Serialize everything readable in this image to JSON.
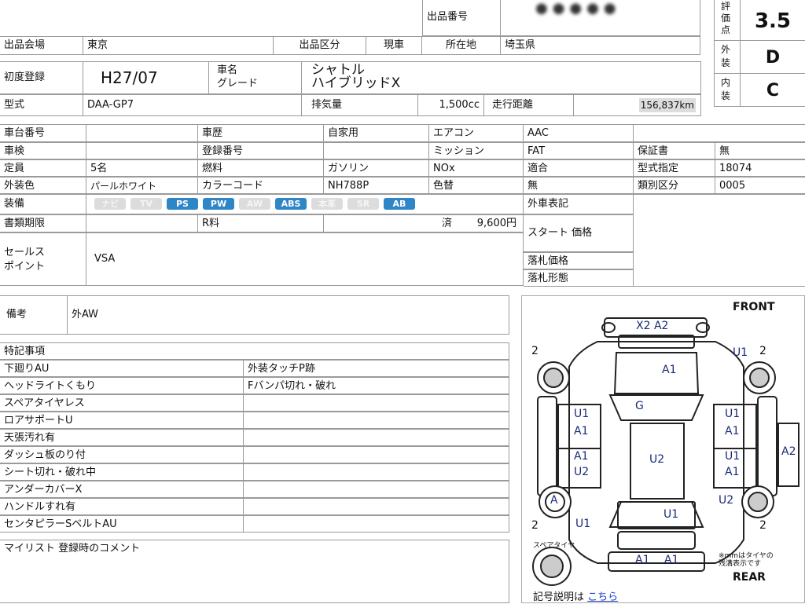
{
  "header": {
    "lot_no_label": "出品番号",
    "lot_no_value": "",
    "venue_label": "出品会場",
    "venue_value": "東京",
    "category_label": "出品区分",
    "category_value": "現車",
    "location_label": "所在地",
    "location_value": "埼玉県"
  },
  "grades": {
    "score_label": "評価点",
    "score_value": "3.5",
    "exterior_label": "外装",
    "exterior_value": "D",
    "interior_label": "内装",
    "interior_value": "C"
  },
  "car": {
    "first_reg_label": "初度登録",
    "first_reg_value": "H27/07",
    "name_label": "車名",
    "grade_label": "グレード",
    "name_value": "シャトル",
    "grade_value": "ハイブリッドX",
    "model_label": "型式",
    "model_value": "DAA-GP7",
    "displacement_label": "排気量",
    "displacement_value": "1,500cc",
    "mileage_label": "走行距離",
    "mileage_value": "156,837km"
  },
  "details": {
    "chassis_label": "車台番号",
    "chassis_value": "",
    "history_label": "車歴",
    "history_value": "自家用",
    "ac_label": "エアコン",
    "ac_value": "AAC",
    "inspection_label": "車検",
    "inspection_value": "",
    "reg_no_label": "登録番号",
    "reg_no_value": "",
    "mission_label": "ミッション",
    "mission_value": "FAT",
    "warranty_label": "保証書",
    "warranty_value": "無",
    "capacity_label": "定員",
    "capacity_value": "5名",
    "fuel_label": "燃料",
    "fuel_value": "ガソリン",
    "nox_label": "NOx",
    "nox_value": "適合",
    "type_designation_label": "型式指定",
    "type_designation_value": "18074",
    "color_label": "外装色",
    "color_value": "パールホワイト",
    "color_code_label": "カラーコード",
    "color_code_value": "NH788P",
    "color_change_label": "色替",
    "color_change_value": "無",
    "class_label": "類別区分",
    "class_value": "0005",
    "equipment_label": "装備",
    "equipment": [
      {
        "label": "ナビ",
        "active": false
      },
      {
        "label": "TV",
        "active": false
      },
      {
        "label": "PS",
        "active": true
      },
      {
        "label": "PW",
        "active": true
      },
      {
        "label": "AW",
        "active": false
      },
      {
        "label": "ABS",
        "active": true
      },
      {
        "label": "本革",
        "active": false
      },
      {
        "label": "SR",
        "active": false
      },
      {
        "label": "AB",
        "active": true
      }
    ],
    "odometer_note_label": "外車表記",
    "odometer_note_value": "",
    "docs_label": "書類期限",
    "docs_value": "",
    "recycle_label": "R料",
    "recycle_status": "済",
    "recycle_value": "9,600円",
    "start_price_label": "スタート 価格",
    "start_price_value": "",
    "sales_point_label_1": "セールス",
    "sales_point_label_2": "ポイント",
    "sales_point_value": "VSA",
    "winning_price_label": "落札価格",
    "winning_price_value": "",
    "winning_type_label": "落札形態",
    "winning_type_value": ""
  },
  "remarks": {
    "label": "備考",
    "value": "外AW"
  },
  "special": {
    "title": "特記事項",
    "left": [
      "下廻りAU",
      "ヘッドライトくもり",
      "スペアタイヤレス",
      "ロアサポートU",
      "天張汚れ有",
      "ダッシュ板のり付",
      "シート切れ・破れ中",
      "アンダーカバーX",
      "ハンドルすれ有",
      "センタピラーSベルトAU"
    ],
    "right": [
      "外装タッチP跡",
      "Fバンパ切れ・破れ"
    ]
  },
  "my_list": {
    "label": "マイリスト 登録時のコメント"
  },
  "diagram": {
    "front_label": "FRONT",
    "rear_label": "REAR",
    "spare_label": "スペアタイヤ",
    "note_line1": "※mmはタイヤの",
    "note_line2": "残溝表示です",
    "legend_label": "記号説明は",
    "legend_link": "こちら",
    "marks": {
      "bumper_front": "X2 A2",
      "hood": "A1",
      "windshield": "G",
      "roof": "U2",
      "rear_glass": "U1",
      "bumper_rear": "A1 A1",
      "left_front_door_1": "U1",
      "left_front_door_2": "A1",
      "left_rear_door_1": "A1",
      "left_rear_door_2": "U2",
      "right_front_door_1": "U1",
      "right_front_door_2": "A1",
      "right_rear_door_1": "U1",
      "right_rear_door_2": "A1",
      "right_quarter": "A2",
      "left_rear_wheel": "A",
      "left_quarter": "U1",
      "right_front_wheel": "U1",
      "right_rear_wheel": "U2",
      "tire_lf": "2",
      "tire_rf": "2",
      "tire_lr": "2",
      "tire_rr": "2"
    }
  }
}
